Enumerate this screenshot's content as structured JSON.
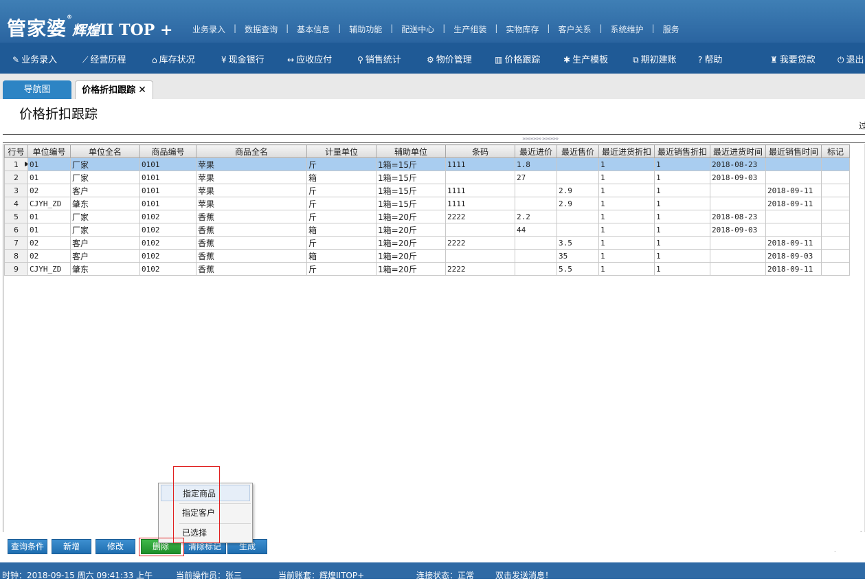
{
  "logo": {
    "part1": "管家婆",
    "reg": "®",
    "part2": "辉煌",
    "part3": "II TOP +"
  },
  "top_menu": [
    "业务录入",
    "数据查询",
    "基本信息",
    "辅助功能",
    "配送中心",
    "生产组装",
    "实物库存",
    "客户关系",
    "系统维护",
    "服务"
  ],
  "top_menu_sep": "|",
  "toolbar": {
    "items": [
      {
        "icon": "edit-icon",
        "glyph": "✎",
        "label": "业务录入"
      },
      {
        "icon": "chart-icon",
        "glyph": "⟋",
        "label": "经营历程"
      },
      {
        "icon": "home-icon",
        "glyph": "⌂",
        "label": "库存状况"
      },
      {
        "icon": "yen-icon",
        "glyph": "¥",
        "label": "现金银行"
      },
      {
        "icon": "arrows-icon",
        "glyph": "↔",
        "label": "应收应付"
      },
      {
        "icon": "search-icon",
        "glyph": "⚲",
        "label": "销售统计"
      },
      {
        "icon": "gear-icon",
        "glyph": "⚙",
        "label": "物价管理"
      },
      {
        "icon": "bar-chart-icon",
        "glyph": "▥",
        "label": "价格跟踪"
      },
      {
        "icon": "wrench-icon",
        "glyph": "✱",
        "label": "生产模板"
      },
      {
        "icon": "external-link-icon",
        "glyph": "⧉",
        "label": "期初建账"
      },
      {
        "icon": "help-icon",
        "glyph": "?",
        "label": "帮助"
      },
      {
        "icon": "money-bag-icon",
        "glyph": "♜",
        "label": "我要贷款"
      },
      {
        "icon": "power-icon",
        "glyph": "⏻",
        "label": "退出"
      }
    ]
  },
  "tabs": {
    "nav": "导航图",
    "current": "价格折扣跟踪",
    "close": "✕"
  },
  "page_title": "价格折扣跟踪",
  "cut_text": "过",
  "grip": "»»»»»»»  »»»»»»",
  "grid": {
    "headers": [
      "行号",
      "单位编号",
      "单位全名",
      "商品编号",
      "商品全名",
      "计量单位",
      "辅助单位",
      "条码",
      "最近进价",
      "最近售价",
      "最近进货折扣",
      "最近销售折扣",
      "最近进货时间",
      "最近销售时间",
      "标记"
    ],
    "rows": [
      [
        "1",
        "01",
        "厂家",
        "0101",
        "苹果",
        "斤",
        "1箱=15斤",
        "1111",
        "1.8",
        "",
        "1",
        "1",
        "2018-08-23",
        "",
        ""
      ],
      [
        "2",
        "01",
        "厂家",
        "0101",
        "苹果",
        "箱",
        "1箱=15斤",
        "",
        "27",
        "",
        "1",
        "1",
        "2018-09-03",
        "",
        ""
      ],
      [
        "3",
        "02",
        "客户",
        "0101",
        "苹果",
        "斤",
        "1箱=15斤",
        "1111",
        "",
        "2.9",
        "1",
        "1",
        "",
        "2018-09-11",
        ""
      ],
      [
        "4",
        "CJYH_ZD",
        "肇东",
        "0101",
        "苹果",
        "斤",
        "1箱=15斤",
        "1111",
        "",
        "2.9",
        "1",
        "1",
        "",
        "2018-09-11",
        ""
      ],
      [
        "5",
        "01",
        "厂家",
        "0102",
        "香蕉",
        "斤",
        "1箱=20斤",
        "2222",
        "2.2",
        "",
        "1",
        "1",
        "2018-08-23",
        "",
        ""
      ],
      [
        "6",
        "01",
        "厂家",
        "0102",
        "香蕉",
        "箱",
        "1箱=20斤",
        "",
        "44",
        "",
        "1",
        "1",
        "2018-09-03",
        "",
        ""
      ],
      [
        "7",
        "02",
        "客户",
        "0102",
        "香蕉",
        "斤",
        "1箱=20斤",
        "2222",
        "",
        "3.5",
        "1",
        "1",
        "",
        "2018-09-11",
        ""
      ],
      [
        "8",
        "02",
        "客户",
        "0102",
        "香蕉",
        "箱",
        "1箱=20斤",
        "",
        "",
        "35",
        "1",
        "1",
        "",
        "2018-09-03",
        ""
      ],
      [
        "9",
        "CJYH_ZD",
        "肇东",
        "0102",
        "香蕉",
        "斤",
        "1箱=20斤",
        "2222",
        "",
        "5.5",
        "1",
        "1",
        "",
        "2018-09-11",
        ""
      ]
    ],
    "selected_row": 1,
    "row_pointer": "▶"
  },
  "context_menu": {
    "items": [
      "指定商品",
      "指定客户",
      "已选择"
    ]
  },
  "buttons": {
    "query": "查询条件",
    "add": "新增",
    "edit": "修改",
    "delete": "删除",
    "clear_mark": "清除标记",
    "generate": "生成"
  },
  "status": {
    "time": "时钟：2018-09-15 周六 09:41:33 上午",
    "operator": "当前操作员：张三",
    "account": "当前账套：辉煌IITOP+",
    "connection": "连接状态：正常",
    "message": "双击发送消息！"
  }
}
